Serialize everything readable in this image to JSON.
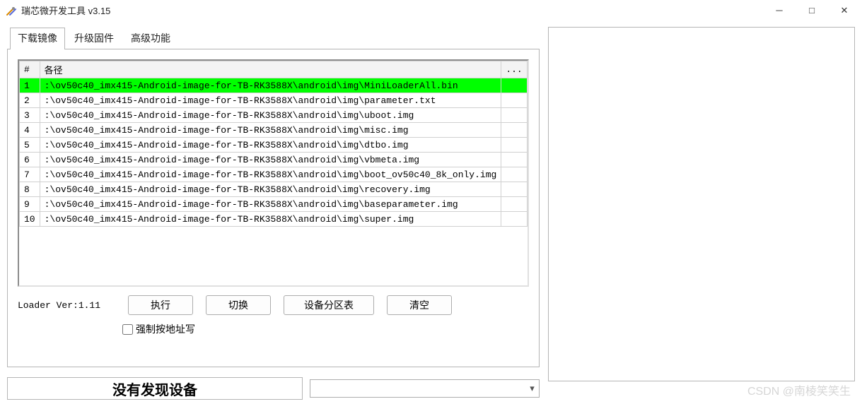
{
  "window": {
    "title": "瑞芯微开发工具 v3.15",
    "minimize": "─",
    "maximize": "□",
    "close": "✕"
  },
  "tabs": [
    {
      "label": "下载镜像",
      "active": true
    },
    {
      "label": "升级固件",
      "active": false
    },
    {
      "label": "高级功能",
      "active": false
    }
  ],
  "table": {
    "header_index": "#",
    "header_path": "各径",
    "header_more": "...",
    "rows": [
      {
        "idx": "1",
        "path": ":\\ov50c40_imx415-Android-image-for-TB-RK3588X\\android\\img\\MiniLoaderAll.bin",
        "highlight": true
      },
      {
        "idx": "2",
        "path": ":\\ov50c40_imx415-Android-image-for-TB-RK3588X\\android\\img\\parameter.txt",
        "highlight": false
      },
      {
        "idx": "3",
        "path": ":\\ov50c40_imx415-Android-image-for-TB-RK3588X\\android\\img\\uboot.img",
        "highlight": false
      },
      {
        "idx": "4",
        "path": ":\\ov50c40_imx415-Android-image-for-TB-RK3588X\\android\\img\\misc.img",
        "highlight": false
      },
      {
        "idx": "5",
        "path": ":\\ov50c40_imx415-Android-image-for-TB-RK3588X\\android\\img\\dtbo.img",
        "highlight": false
      },
      {
        "idx": "6",
        "path": ":\\ov50c40_imx415-Android-image-for-TB-RK3588X\\android\\img\\vbmeta.img",
        "highlight": false
      },
      {
        "idx": "7",
        "path": ":\\ov50c40_imx415-Android-image-for-TB-RK3588X\\android\\img\\boot_ov50c40_8k_only.img",
        "highlight": false
      },
      {
        "idx": "8",
        "path": ":\\ov50c40_imx415-Android-image-for-TB-RK3588X\\android\\img\\recovery.img",
        "highlight": false
      },
      {
        "idx": "9",
        "path": ":\\ov50c40_imx415-Android-image-for-TB-RK3588X\\android\\img\\baseparameter.img",
        "highlight": false
      },
      {
        "idx": "10",
        "path": ":\\ov50c40_imx415-Android-image-for-TB-RK3588X\\android\\img\\super.img",
        "highlight": false
      }
    ]
  },
  "actions": {
    "loader_ver_label": "Loader Ver:1.11",
    "execute": "执行",
    "switch": "切换",
    "partition_table": "设备分区表",
    "clear": "清空"
  },
  "checkbox": {
    "force_write_label": "强制按地址写",
    "checked": false
  },
  "status": {
    "no_device": "没有发现设备",
    "combo_placeholder": ""
  },
  "watermark": "CSDN @南棱笑笑生",
  "icons": {
    "chevron_down": "▾"
  }
}
